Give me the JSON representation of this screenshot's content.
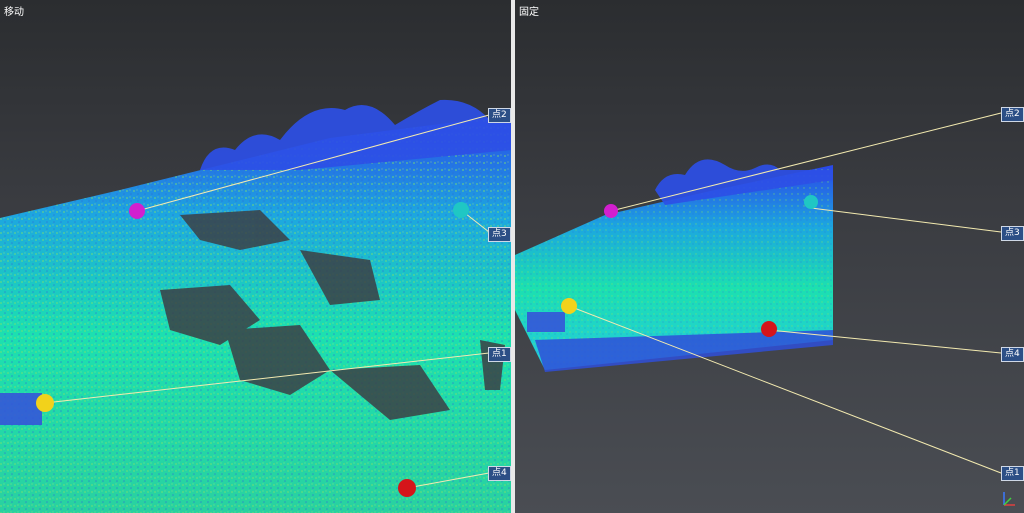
{
  "views": {
    "left": {
      "title": "移动",
      "labels": [
        "点2",
        "点3",
        "点1",
        "点4"
      ]
    },
    "right": {
      "title": "固定",
      "labels": [
        "点2",
        "点3",
        "点4",
        "点1"
      ]
    }
  },
  "colors": {
    "point1": "#f2d21b",
    "point2": "#d21fcf",
    "point3": "#1fc7c4",
    "point4": "#d5151a",
    "cloud_low": "#19e6a8",
    "cloud_high": "#2a45e8",
    "label_bg": "#2c4f86",
    "leader_line": "#f3eab0"
  }
}
